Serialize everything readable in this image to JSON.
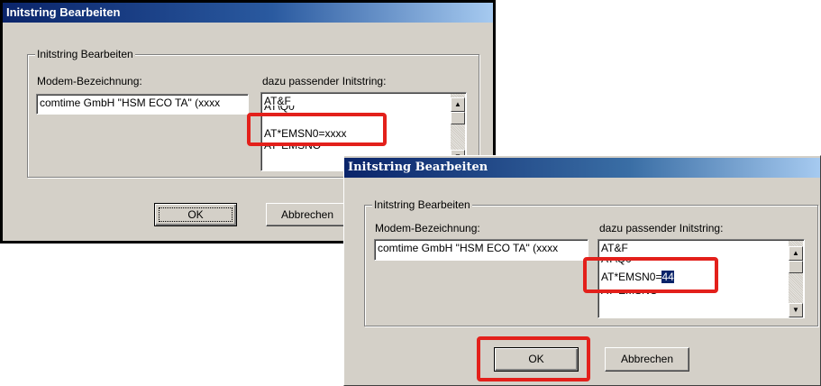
{
  "dialog1": {
    "title": "Initstring Bearbeiten",
    "group_label": "Initstring Bearbeiten",
    "modem_label": "Modem-Bezeichnung:",
    "modem_value": "comtime GmbH \"HSM ECO TA\" (xxxx",
    "initstring_label": "dazu passender Initstring:",
    "initstring_lines": [
      "AT&F",
      "AT\\Q0",
      "AT*EMSN0=xxxx",
      "AT*EMSNO"
    ],
    "ok_label": "OK",
    "cancel_label": "Abbrechen"
  },
  "dialog2": {
    "title": "Initstring Bearbeiten",
    "group_label": "Initstring Bearbeiten",
    "modem_label": "Modem-Bezeichnung:",
    "modem_value": "comtime GmbH \"HSM ECO TA\" (xxxx",
    "initstring_label": "dazu passender Initstring:",
    "initstring_lines": [
      "AT&F",
      "AT\\Q0",
      "AT*EMSN0=",
      "AT*EMSNO"
    ],
    "initstring_selected": "44",
    "ok_label": "OK",
    "cancel_label": "Abbrechen"
  },
  "colors": {
    "highlight_box": "#e3201b",
    "titlebar": "#0a246a",
    "dialog_bg": "#d4d0c8"
  }
}
